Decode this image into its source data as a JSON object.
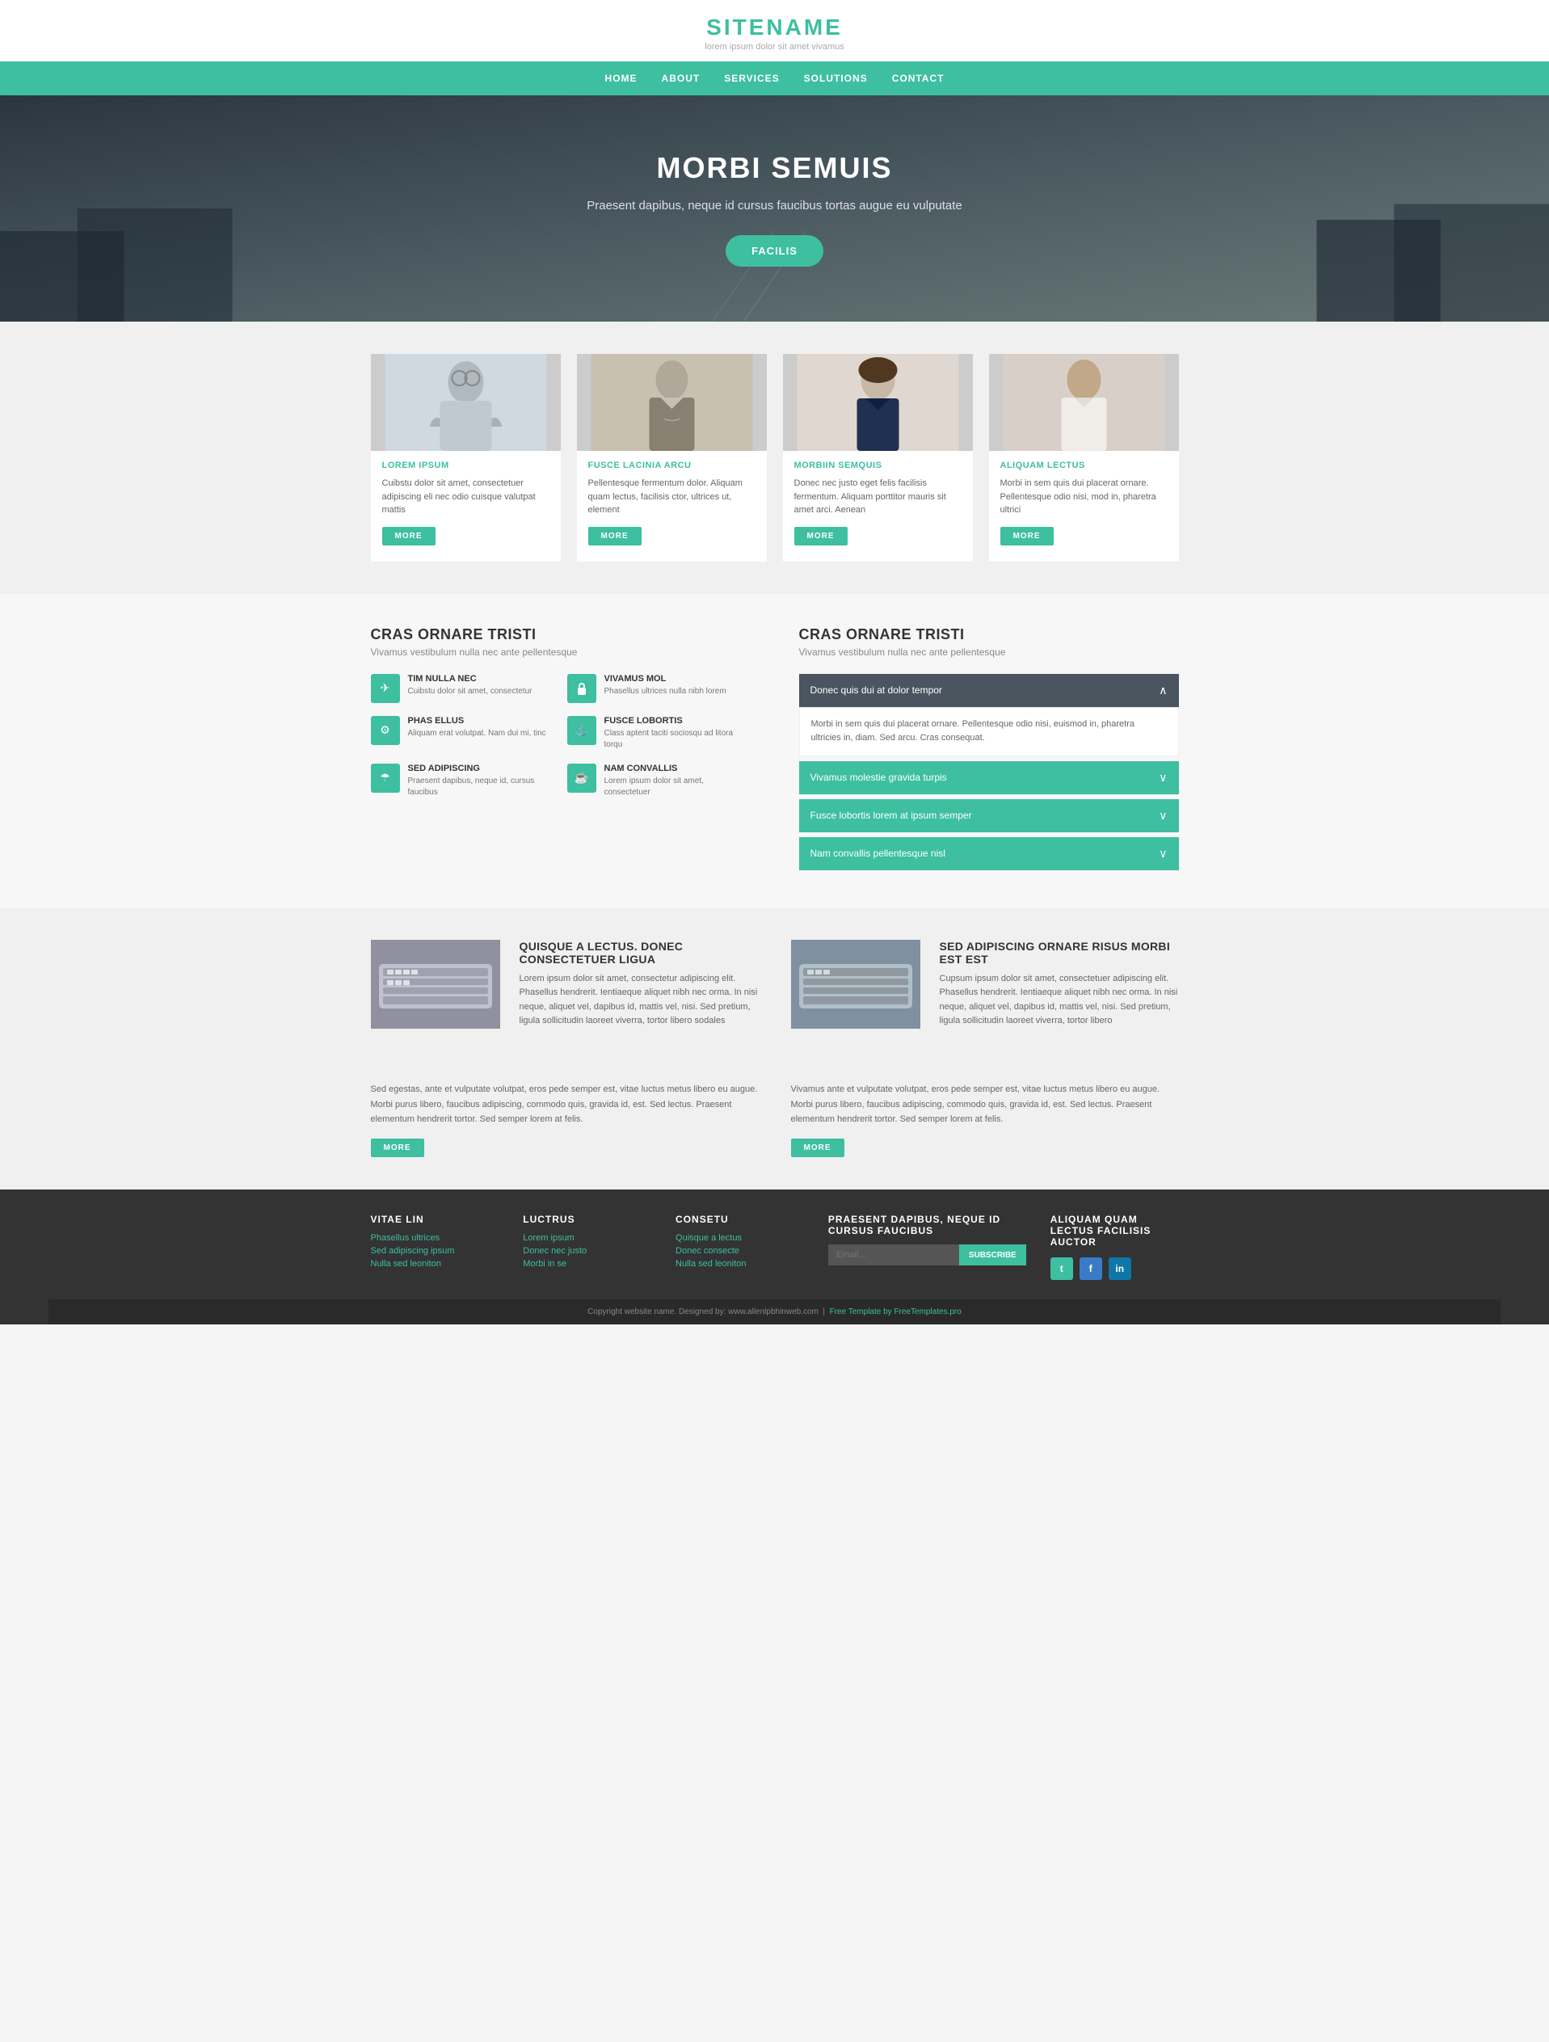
{
  "header": {
    "site_title": "SITENAME",
    "tagline": "lorem ipsum dolor sit amet vivamus"
  },
  "nav": {
    "items": [
      "HOME",
      "ABOUT",
      "SERVICES",
      "SOLUTIONS",
      "CONTACT"
    ]
  },
  "hero": {
    "heading": "MORBI SEMUIS",
    "subtext": "Praesent dapibus, neque id cursus faucibus tortas augue eu vulputate",
    "cta_label": "FACILIS"
  },
  "cards": {
    "items": [
      {
        "title": "LOREM IPSUM",
        "text": "Cuibstu dolor sit amet, consectetuer adipiscing eli nec odio cuisque valutpat mattis",
        "btn": "MORE"
      },
      {
        "title": "FUSCE LACINIA ARCU",
        "text": "Pellentesque fermentum dolor. Aliquam quam lectus, facilisis ctor, ultrices ut, element",
        "btn": "MORE"
      },
      {
        "title": "MORBIIN SEMQUIS",
        "text": "Donec nec justo eget felis facilisis fermentum. Aliquam porttitor mauris sit amet arci. Aenean",
        "btn": "MORE"
      },
      {
        "title": "ALIQUAM LECTUS",
        "text": "Morbi in sem quis dui placerat ornare. Pellentesque odio nisi, mod in, pharetra ultrici",
        "btn": "MORE"
      }
    ]
  },
  "features_left": {
    "heading": "CRAS ORNARE TRISTI",
    "subheading": "Vivamus vestibulum nulla nec ante pellentesque",
    "items": [
      {
        "icon": "✈",
        "title": "TIM NULLA NEC",
        "text": "Cuibstu dolor sit amet, consectetur"
      },
      {
        "icon": "🔒",
        "title": "VIVAMUS MOL",
        "text": "Phasellus ultrices nulla nibh lorem"
      },
      {
        "icon": "⚙",
        "title": "PHAS ELLUS",
        "text": "Aliquam erat volutpat. Nam dui mi, tinc"
      },
      {
        "icon": "⚓",
        "title": "FUSCE LOBORTIS",
        "text": "Class aptent taciti sociosqu ad litora torqu"
      },
      {
        "icon": "☂",
        "title": "SED ADIPISCING",
        "text": "Praesent dapibus, neque id, cursus faucibus"
      },
      {
        "icon": "☕",
        "title": "NAM CONVALLIS",
        "text": "Lorem ipsum dolor sit amet, consectetuer"
      }
    ]
  },
  "features_right": {
    "heading": "CRAS ORNARE TRISTI",
    "subheading": "Vivamus vestibulum nulla nec ante pellentesque",
    "accordion": {
      "active_item": {
        "label": "Donec quis dui at dolor tempor",
        "body": "Morbi in sem quis dui placerat ornare. Pellentesque odio nisi, euismod in, pharetra ultricies in, diam. Sed arcu. Cras consequat."
      },
      "collapsed_items": [
        "Vivamus molestie gravida turpis",
        "Fusce lobortis lorem at ipsum semper",
        "Nam convallis pellentesque nisl"
      ]
    }
  },
  "content_blocks": {
    "block1": {
      "title": "QUISQUE A LECTUS. DONEC CONSECTETUER LIGUA",
      "text": "Lorem ipsum dolor sit amet, consectetur adipiscing elit. Phasellus hendrerit. Ientiaeque aliquet nibh nec orma. In nisi neque, aliquet vel, dapibus id, mattis vel, nisi. Sed pretium, ligula sollicitudin laoreet viverra, tortor libero sodales"
    },
    "block2": {
      "title": "SED ADIPISCING ORNARE RISUS MORBI EST EST",
      "text": "Cupsum ipsum dolor sit amet, consectetuer adipiscing elit. Phasellus hendrerit. Ientiaeque aliquet nibh nec orma. In nisi neque, aliquet vel, dapibus id, mattis vel, nisi. Sed pretium, ligula sollicitudin laoreet viverra, tortor libero"
    },
    "bottom_left": "Sed egestas, ante et vulputate volutpat, eros pede semper est, vitae luctus metus libero eu augue. Morbi purus libero, faucibus adipiscing, commodo quis, gravida id, est. Sed lectus. Praesent elementum hendrerit tortor. Sed semper lorem at felis.",
    "bottom_right": "Vivamus ante et vulputate volutpat, eros pede semper est, vitae luctus metus libero eu augue. Morbi purus libero, faucibus adipiscing, commodo quis, gravida id, est. Sed lectus. Praesent elementum hendrerit tortor. Sed semper lorem at felis.",
    "more_btn_left": "MORE",
    "more_btn_right": "MORE"
  },
  "footer": {
    "col1_title": "VITAE LIN",
    "col1_links": [
      "Phasellus ultrices",
      "Sed adipiscing ipsum",
      "Nulla sed leoniton"
    ],
    "col2_title": "LUCTRUS",
    "col2_links": [
      "Lorem ipsum",
      "Donec nec justo",
      "Morbi in se"
    ],
    "col3_title": "CONSETU",
    "col3_links": [
      "Quisque a lectus",
      "Donec consecte",
      "Nulla sed leoniton"
    ],
    "col4_title": "PRAESENT DAPIBUS, NEQUE ID CURSUS FAUCIBUS",
    "col4_placeholder": "",
    "col4_subscribe": "SUBSCRIBE",
    "col5_title": "ALIQUAM QUAM LECTUS FACILISIS AUCTOR",
    "social": [
      "t",
      "f",
      "in"
    ],
    "copyright": "Copyright website name. Designed by: www.allenlpbhinweb.com",
    "free_template": "Free Template by FreeTemplates.pro"
  }
}
